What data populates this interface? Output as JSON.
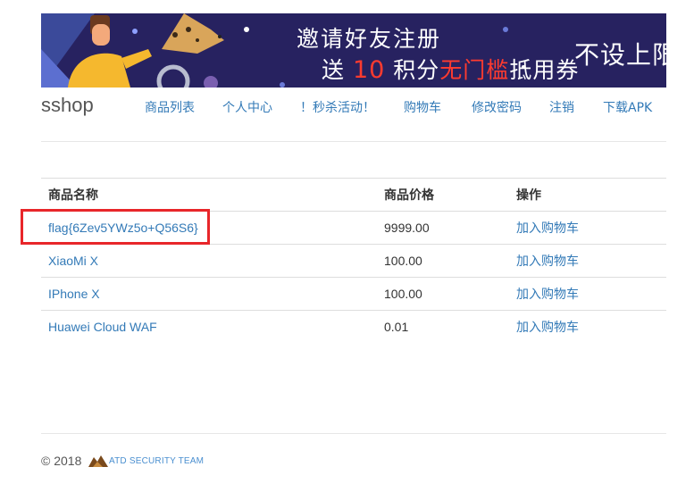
{
  "banner": {
    "line1": "邀请好友注册",
    "line2_prefix": "送",
    "line2_number": "10",
    "line2_mid": "积分",
    "line2_highlight": "无门槛",
    "line2_suffix": "抵用券",
    "right_text": "不设上限"
  },
  "navbar": {
    "brand": "sshop",
    "items": [
      {
        "label": "商品列表"
      },
      {
        "label": "个人中心"
      },
      {
        "label": "！秒杀活动！"
      },
      {
        "label": "购物车"
      },
      {
        "label": "修改密码"
      },
      {
        "label": "注销"
      },
      {
        "label": "下载APK"
      }
    ]
  },
  "table": {
    "headers": [
      "商品名称",
      "商品价格",
      "操作"
    ],
    "rows": [
      {
        "name": "flag{6Zev5YWz5o+Q56S6}",
        "price": "9999.00",
        "action": "加入购物车"
      },
      {
        "name": "XiaoMi X",
        "price": "100.00",
        "action": "加入购物车"
      },
      {
        "name": "IPhone X",
        "price": "100.00",
        "action": "加入购物车"
      },
      {
        "name": "Huawei Cloud WAF",
        "price": "0.01",
        "action": "加入购物车"
      }
    ]
  },
  "footer": {
    "copyright": "© 2018",
    "team": "ATD SECURITY TEAM"
  },
  "colors": {
    "banner_bg": "#272260",
    "link": "#337ab7",
    "highlight_box": "#e8262a",
    "banner_accent": "#ff3b2f"
  },
  "icons": {
    "banner_person": "person-illustration",
    "banner_animal": "hedgehog-illustration",
    "footer_logo": "atd-fox-logo"
  }
}
